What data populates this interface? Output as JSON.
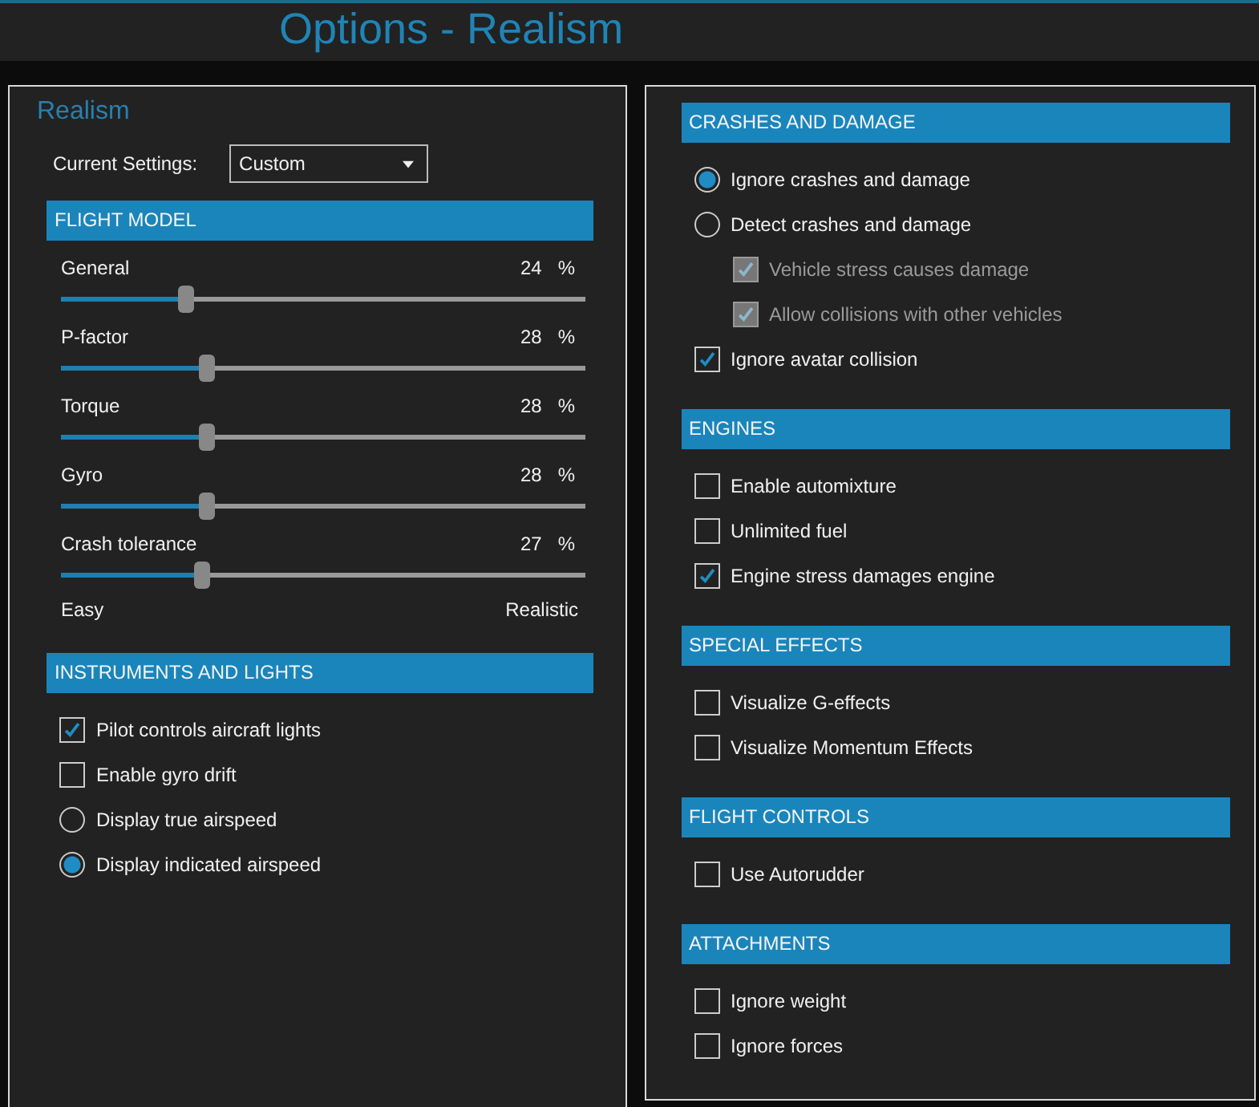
{
  "title": "Options - Realism",
  "left_panel": {
    "heading": "Realism",
    "current_settings": {
      "label": "Current Settings:",
      "value": "Custom"
    },
    "sections": [
      {
        "title": "FLIGHT MODEL",
        "kind": "sliders",
        "sliders": [
          {
            "label": "General",
            "level": 0.24,
            "reading": "24",
            "unit": "%"
          },
          {
            "label": "P-factor",
            "level": 0.28,
            "reading": "28",
            "unit": "%"
          },
          {
            "label": "Torque",
            "level": 0.28,
            "reading": "28",
            "unit": "%"
          },
          {
            "label": "Gyro",
            "level": 0.28,
            "reading": "28",
            "unit": "%"
          },
          {
            "label": "Crash tolerance",
            "level": 0.27,
            "reading": "27",
            "unit": "%"
          }
        ],
        "scale": {
          "min_label": "Easy",
          "max_label": "Realistic"
        }
      },
      {
        "title": "INSTRUMENTS AND LIGHTS",
        "kind": "options",
        "options": [
          {
            "kind": "checkbox",
            "label": "Pilot controls aircraft lights",
            "checked": true
          },
          {
            "kind": "checkbox",
            "label": "Enable gyro drift",
            "checked": false
          },
          {
            "kind": "radio",
            "label": "Display true airspeed",
            "selected": false
          },
          {
            "kind": "radio",
            "label": "Display indicated airspeed",
            "selected": true
          }
        ]
      }
    ]
  },
  "right_panel": {
    "sections": [
      {
        "title": "CRASHES AND DAMAGE",
        "kind": "options",
        "options": [
          {
            "kind": "radio",
            "label": "Ignore crashes and damage",
            "selected": true
          },
          {
            "kind": "radio",
            "label": "Detect crashes and damage",
            "selected": false,
            "children": [
              {
                "kind": "checkbox",
                "label": "Vehicle stress causes damage",
                "checked": true,
                "disabled": true
              },
              {
                "kind": "checkbox",
                "label": "Allow collisions with other vehicles",
                "checked": true,
                "disabled": true
              }
            ]
          },
          {
            "kind": "checkbox",
            "label": "Ignore avatar collision",
            "checked": true
          }
        ]
      },
      {
        "title": "ENGINES",
        "kind": "options",
        "options": [
          {
            "kind": "checkbox",
            "label": "Enable automixture",
            "checked": false
          },
          {
            "kind": "checkbox",
            "label": "Unlimited fuel",
            "checked": false
          },
          {
            "kind": "checkbox",
            "label": "Engine stress damages engine",
            "checked": true
          }
        ]
      },
      {
        "title": "SPECIAL EFFECTS",
        "kind": "options",
        "options": [
          {
            "kind": "checkbox",
            "label": "Visualize G-effects",
            "checked": false
          },
          {
            "kind": "checkbox",
            "label": "Visualize Momentum Effects",
            "checked": false
          }
        ]
      },
      {
        "title": "FLIGHT CONTROLS",
        "kind": "options",
        "options": [
          {
            "kind": "checkbox",
            "label": "Use Autorudder",
            "checked": false
          }
        ]
      },
      {
        "title": "ATTACHMENTS",
        "kind": "options",
        "options": [
          {
            "kind": "checkbox",
            "label": "Ignore weight",
            "checked": false
          },
          {
            "kind": "checkbox",
            "label": "Ignore forces",
            "checked": false
          }
        ]
      }
    ]
  }
}
